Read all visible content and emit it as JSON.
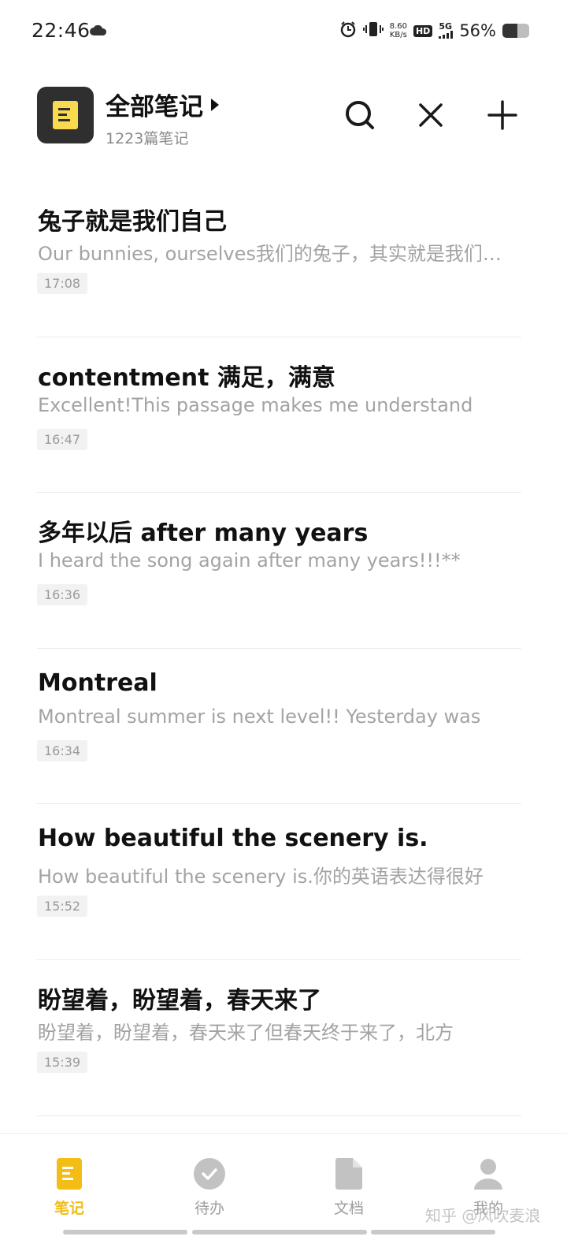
{
  "status_bar": {
    "time": "22:46",
    "net_speed_value": "8.60",
    "net_speed_unit": "KB/s",
    "hd": "HD",
    "signal": "5G",
    "battery": "56%",
    "battery_level": 0.56,
    "icons": [
      "cloud-icon",
      "alarm-icon",
      "vibrate-icon",
      "signal-icon",
      "battery-icon"
    ]
  },
  "header": {
    "title": "全部笔记",
    "subtitle": "1223篇笔记",
    "accent": "#f9d94d"
  },
  "notes": [
    {
      "title": "兔子就是我们自己",
      "preview": "Our bunnies, ourselves我们的兔子，其实就是我们自己",
      "time": "17:08"
    },
    {
      "title": "contentment 满足，满意",
      "preview": "Excellent!This passage makes me understand",
      "time": "16:47"
    },
    {
      "title": "多年以后 after many years",
      "preview": "I heard the song again after many years!!!** ",
      "time": "16:36"
    },
    {
      "title": "Montreal",
      "preview": "Montreal summer is next level!! Yesterday was",
      "time": "16:34"
    },
    {
      "title": "How beautiful the scenery is.",
      "preview": "How beautiful the scenery is.你的英语表达得很好",
      "time": "15:52"
    },
    {
      "title": "盼望着，盼望着，春天来了",
      "preview": "盼望着，盼望着，春天来了但春天终于来了，北方",
      "time": "15:39"
    }
  ],
  "bottom_nav": {
    "tabs": [
      {
        "label": "笔记",
        "icon": "note-icon",
        "active": true
      },
      {
        "label": "待办",
        "icon": "check-circle-icon",
        "active": false
      },
      {
        "label": "文档",
        "icon": "document-icon",
        "active": false
      },
      {
        "label": "我的",
        "icon": "profile-icon",
        "active": false
      }
    ],
    "active_color": "#f3bd16",
    "inactive_color": "#9d9d9d"
  },
  "watermark": "知乎 @风吹麦浪"
}
